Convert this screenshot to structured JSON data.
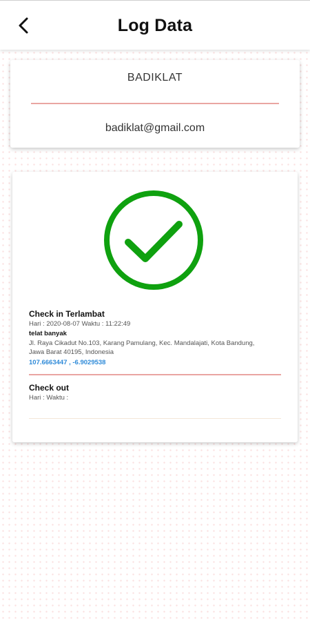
{
  "app_bar": {
    "title": "Log Data",
    "back_icon": "chevron-left-icon"
  },
  "user": {
    "name": "BADIKLAT",
    "email": "badiklat@gmail.com"
  },
  "check_in": {
    "status_icon": "check-circle-icon",
    "status_color": "#0fa10f",
    "title": "Check in Terlambat",
    "datetime": "Hari : 2020-08-07 Waktu : 11:22:49",
    "note": "telat banyak",
    "address": "Jl. Raya Cikadut No.103, Karang Pamulang, Kec. Mandalajati, Kota Bandung, Jawa Barat 40195, Indonesia",
    "coordinates": "107.6663447 , -6.9029538"
  },
  "check_out": {
    "title": "Check out",
    "datetime": "Hari :  Waktu :"
  },
  "colors": {
    "divider": "#e9a5a2",
    "coordinates": "#2e8ad8",
    "background_dots": "#e87878"
  }
}
